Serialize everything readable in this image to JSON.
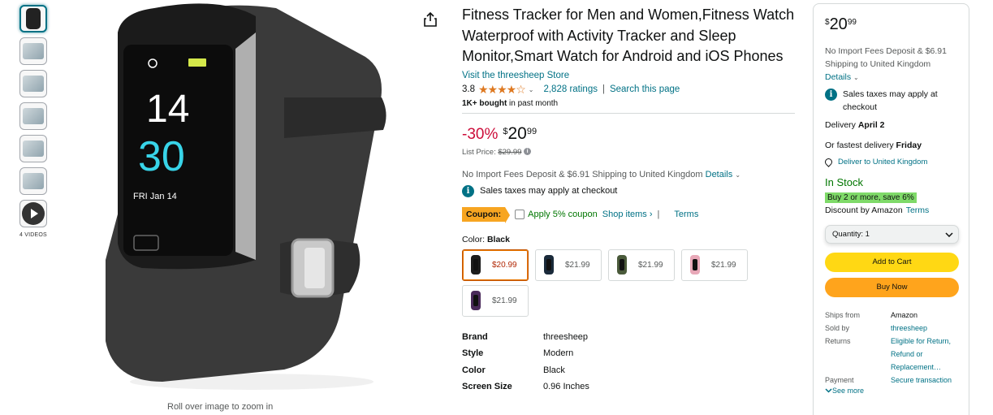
{
  "thumbnails": {
    "count": 7,
    "videos_label": "4 VIDEOS"
  },
  "main_image": {
    "zoom_hint": "Roll over image to zoom in",
    "watch_screen": {
      "hour": "14",
      "minute": "30",
      "date": "FRI  Jan 14"
    }
  },
  "product": {
    "title": "Fitness Tracker for Men and Women,Fitness Watch Waterproof with Activity Tracker and Sleep Monitor,Smart Watch for Android and iOS Phones",
    "store_link": "Visit the threesheep Store",
    "rating": "3.8",
    "stars": "★★★★☆",
    "ratings_count": "2,828 ratings",
    "search_page": "Search this page",
    "bought_bold": "1K+ bought",
    "bought_rest": " in past month"
  },
  "pricing": {
    "discount": "-30%",
    "currency": "$",
    "whole": "20",
    "fraction": "99",
    "list_price_label": "List Price: ",
    "list_price": "$29.99",
    "shipping_text": "No Import Fees Deposit & $6.91 Shipping to United Kingdom ",
    "details_link": "Details",
    "tax_note": "Sales taxes may apply at checkout"
  },
  "coupon": {
    "badge": "Coupon:",
    "apply_text": "Apply 5% coupon",
    "shop_items": "Shop items ›",
    "separator": "|",
    "terms": "Terms"
  },
  "color": {
    "label": "Color: ",
    "selected": "Black",
    "swatches": [
      {
        "price": "$20.99",
        "band_color": "#1c1c1c"
      },
      {
        "price": "$21.99",
        "band_color": "#1a2a3a"
      },
      {
        "price": "$21.99",
        "band_color": "#4a5a3a"
      },
      {
        "price": "$21.99",
        "band_color": "#e8a8b8"
      },
      {
        "price": "$21.99",
        "band_color": "#4a2a5a"
      }
    ]
  },
  "specs": [
    {
      "key": "Brand",
      "value": "threesheep"
    },
    {
      "key": "Style",
      "value": "Modern"
    },
    {
      "key": "Color",
      "value": "Black"
    },
    {
      "key": "Screen Size",
      "value": "0.96 Inches"
    }
  ],
  "buybox": {
    "currency": "$",
    "whole": "20",
    "fraction": "99",
    "shipping": "No Import Fees Deposit & $6.91 Shipping to United Kingdom",
    "details": "Details",
    "tax_note": "Sales taxes may apply at checkout",
    "delivery_label": "Delivery ",
    "delivery_date": "April 2",
    "fastest_label": "Or fastest delivery ",
    "fastest_date": "Friday",
    "deliver_to": "Deliver to United Kingdom",
    "stock": "In Stock",
    "promo": "Buy 2 or more, save 6%",
    "discount_by": "Discount by Amazon",
    "terms": "Terms",
    "quantity": "Quantity:  1",
    "add_to_cart": "Add to Cart",
    "buy_now": "Buy Now",
    "rows": [
      {
        "key": "Ships from",
        "value": "Amazon",
        "link": false
      },
      {
        "key": "Sold by",
        "value": "threesheep",
        "link": true
      },
      {
        "key": "Returns",
        "value": "Eligible for Return, Refund or Replacement…",
        "link": true
      },
      {
        "key": "Payment",
        "value": "Secure transaction",
        "link": true
      }
    ],
    "see_more": "See more"
  },
  "colors": {
    "link": "#007185",
    "deal": "#cc0c39",
    "in_stock": "#007600",
    "cart_button": "#ffd814",
    "buy_button": "#ffa41c",
    "coupon_badge": "#f7a521",
    "promo_highlight": "#7fda69"
  }
}
